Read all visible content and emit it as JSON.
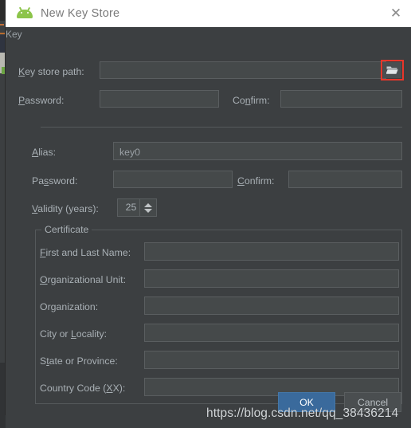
{
  "window": {
    "title": "New Key Store",
    "app_icon": "android-robot-icon",
    "close_icon": "close-icon"
  },
  "keystore": {
    "path_label": "Key store path:",
    "path_label_mnemonic": "K",
    "path_value": "",
    "browse_icon": "folder-open-icon",
    "browse_highlight_color": "#e8362a",
    "password_label": "Password:",
    "password_label_mnemonic": "P",
    "password_value": "",
    "confirm_label": "Confirm:",
    "confirm_label_mnemonic": "n",
    "confirm_value": ""
  },
  "key_group": {
    "legend": "Key",
    "alias_label": "Alias:",
    "alias_label_mnemonic": "A",
    "alias_value": "key0",
    "password_label": "Password:",
    "password_label_mnemonic": "s",
    "password_value": "",
    "confirm_label": "Confirm:",
    "confirm_label_mnemonic": "C",
    "confirm_value": "",
    "validity_label": "Validity (years):",
    "validity_label_mnemonic": "V",
    "validity_value": "25",
    "spinner_up_icon": "chevron-up-icon",
    "spinner_down_icon": "chevron-down-icon"
  },
  "certificate": {
    "legend": "Certificate",
    "fields": [
      {
        "label": "First and Last Name:",
        "mnemonic": "F",
        "value": ""
      },
      {
        "label": "Organizational Unit:",
        "mnemonic": "O",
        "value": ""
      },
      {
        "label": "Organization:",
        "mnemonic": "g",
        "value": ""
      },
      {
        "label": "City or Locality:",
        "mnemonic": "L",
        "value": ""
      },
      {
        "label": "State or Province:",
        "mnemonic": "t",
        "value": ""
      },
      {
        "label": "Country Code (XX):",
        "mnemonic": "X",
        "value": ""
      }
    ]
  },
  "buttons": {
    "ok": "OK",
    "cancel": "Cancel",
    "ok_color": "#3a6a9c"
  },
  "watermark": {
    "text": "https://blog.csdn.net/qq_38436214"
  },
  "theme": {
    "dialog_background": "#3c3f41",
    "titlebar_background": "#ffffff",
    "field_background": "#45494a",
    "border": "#55595b",
    "label_text": "#a9b0b5",
    "title_text": "#7a7a7a"
  }
}
